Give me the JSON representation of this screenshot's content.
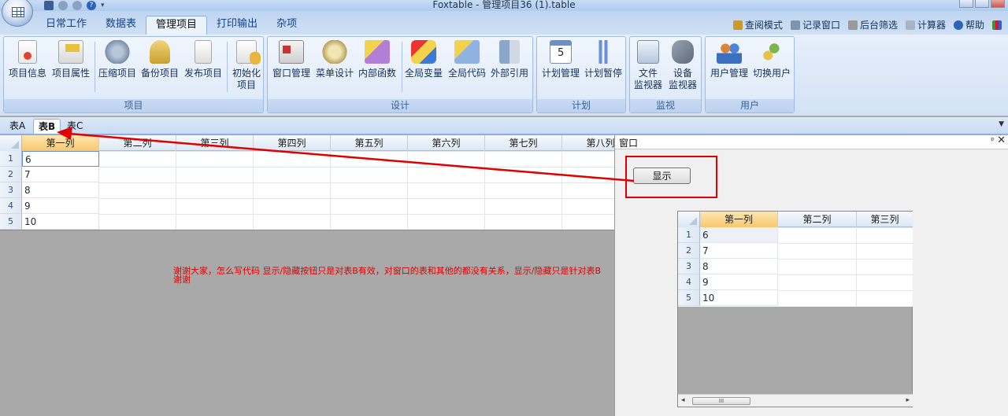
{
  "window": {
    "title": "Foxtable - 管理项目36 (1).table"
  },
  "ribbon_tabs": [
    "日常工作",
    "数据表",
    "管理项目",
    "打印输出",
    "杂项"
  ],
  "right_links": [
    "查阅模式",
    "记录窗口",
    "后台筛选",
    "计算器",
    "帮助"
  ],
  "groups": [
    {
      "title": "项目",
      "buttons": [
        "项目信息",
        "项目属性",
        "压缩项目",
        "备份项目",
        "发布项目",
        "初始化项目"
      ]
    },
    {
      "title": "设计",
      "buttons": [
        "窗口管理",
        "菜单设计",
        "内部函数",
        "全局变量",
        "全局代码",
        "外部引用"
      ]
    },
    {
      "title": "计划",
      "buttons": [
        "计划管理",
        "计划暂停"
      ]
    },
    {
      "title": "监视",
      "buttons": [
        "文件监视器",
        "设备监视器"
      ]
    },
    {
      "title": "用户",
      "buttons": [
        "用户管理",
        "切换用户"
      ]
    }
  ],
  "init_label": {
    "line1": "初始化",
    "line2": "项目"
  },
  "file_mon": {
    "line1": "文件",
    "line2": "监视器"
  },
  "dev_mon": {
    "line1": "设备",
    "line2": "监视器"
  },
  "sheet_tabs": [
    "表A",
    "表B",
    "表C"
  ],
  "main_grid": {
    "columns": [
      "第一列",
      "第二列",
      "第三列",
      "第四列",
      "第五列",
      "第六列",
      "第七列",
      "第八列"
    ],
    "row_numbers": [
      "1",
      "2",
      "3",
      "4",
      "5"
    ],
    "values": [
      "6",
      "7",
      "8",
      "9",
      "10"
    ]
  },
  "panel": {
    "title": "窗口",
    "pin": "ᵖ",
    "close": "✕",
    "button_label": "显示",
    "grid_columns": [
      "第一列",
      "第二列",
      "第三列"
    ],
    "row_numbers": [
      "1",
      "2",
      "3",
      "4",
      "5"
    ],
    "values": [
      "6",
      "7",
      "8",
      "9",
      "10"
    ],
    "scroll_grip": "III"
  },
  "note": {
    "line1": "谢谢大家，怎么写代码 显示/隐藏按钮只是对表B有效，对窗口的表和其他的都没有关系，显示/隐藏只是针对表B",
    "line2": "谢谢"
  },
  "colors": {
    "annotation_red": "#e00000",
    "selected_header": "#f7c86f"
  }
}
